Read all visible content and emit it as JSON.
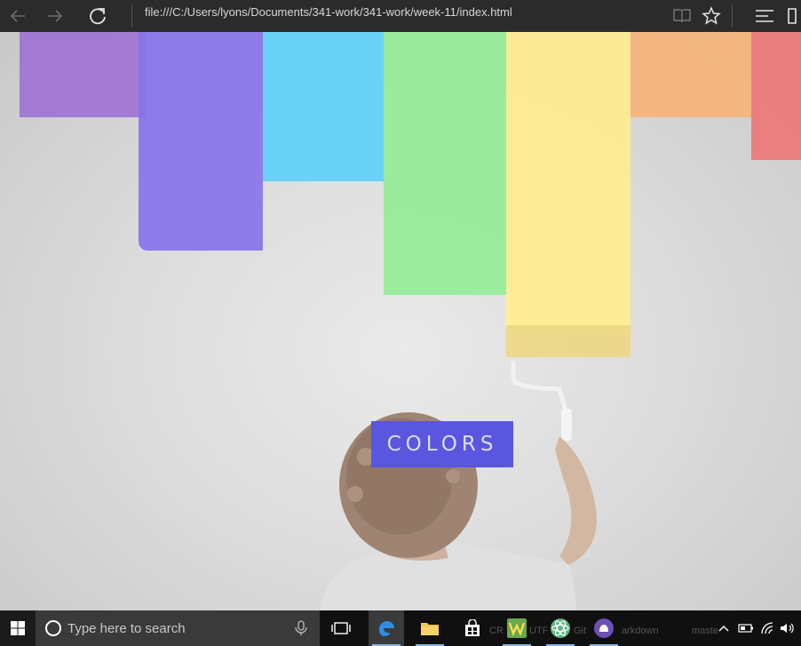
{
  "browser": {
    "url": "file:///C:/Users/lyons/Documents/341-work/341-work/week-11/index.html",
    "icons": [
      "back-arrow-icon",
      "forward-arrow-icon",
      "refresh-icon",
      "reading-view-icon",
      "favorite-star-icon",
      "hub-icon",
      "notes-icon"
    ]
  },
  "page": {
    "hero_title": "COLORS",
    "accent": "#5a56e0",
    "stripe_colors": [
      "#8a55cc",
      "#6e56e4",
      "#3fc8f8",
      "#7de882",
      "#ffe97a",
      "#f4a35c",
      "#e85a5a"
    ]
  },
  "taskbar": {
    "search_placeholder": "Type here to search",
    "ghost_labels": [
      "CR",
      "UTF",
      "Git",
      "arkdown",
      "maste"
    ],
    "icons": [
      "windows-start-icon",
      "cortana-icon",
      "microphone-icon",
      "task-view-icon",
      "edge-icon",
      "file-explorer-icon",
      "store-icon",
      "app-w-icon",
      "atom-icon",
      "github-desktop-icon",
      "chevron-up-icon",
      "battery-icon",
      "wifi-icon",
      "volume-icon"
    ]
  }
}
